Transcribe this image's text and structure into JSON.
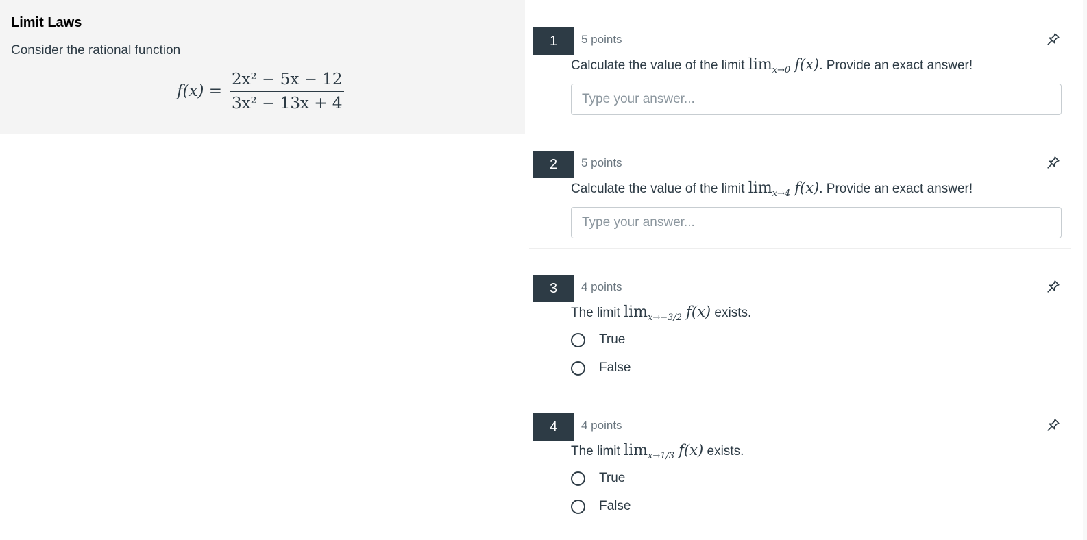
{
  "stimulus": {
    "title": "Limit Laws",
    "text": "Consider the rational function",
    "formula": {
      "lhs": "f(x) =",
      "numerator": "2x² − 5x − 12",
      "denominator": "3x² − 13x + 4"
    }
  },
  "questions": [
    {
      "number": "1",
      "points": "5 points",
      "text_before": "Calculate the value of the limit",
      "lim": "lim",
      "limit_sub": "x→0",
      "fx": "f(x)",
      "text_after": ". Provide an exact answer!",
      "placeholder": "Type your answer..."
    },
    {
      "number": "2",
      "points": "5 points",
      "text_before": "Calculate the value of the limit",
      "lim": "lim",
      "limit_sub": "x→4",
      "fx": "f(x)",
      "text_after": ". Provide an exact answer!",
      "placeholder": "Type your answer..."
    },
    {
      "number": "3",
      "points": "4 points",
      "text_before": "The limit",
      "lim": "lim",
      "limit_sub": "x→−3/2",
      "fx": "f(x)",
      "text_after": " exists.",
      "options": [
        "True",
        "False"
      ]
    },
    {
      "number": "4",
      "points": "4 points",
      "text_before": "The limit",
      "lim": "lim",
      "limit_sub": "x→1/3",
      "fx": "f(x)",
      "text_after": " exists.",
      "options": [
        "True",
        "False"
      ]
    }
  ],
  "icons": {
    "pin": "pin-icon"
  },
  "colors": {
    "accent": "#2d3b45",
    "panel_bg": "#f4f4f4",
    "muted_text": "#6b7780"
  }
}
